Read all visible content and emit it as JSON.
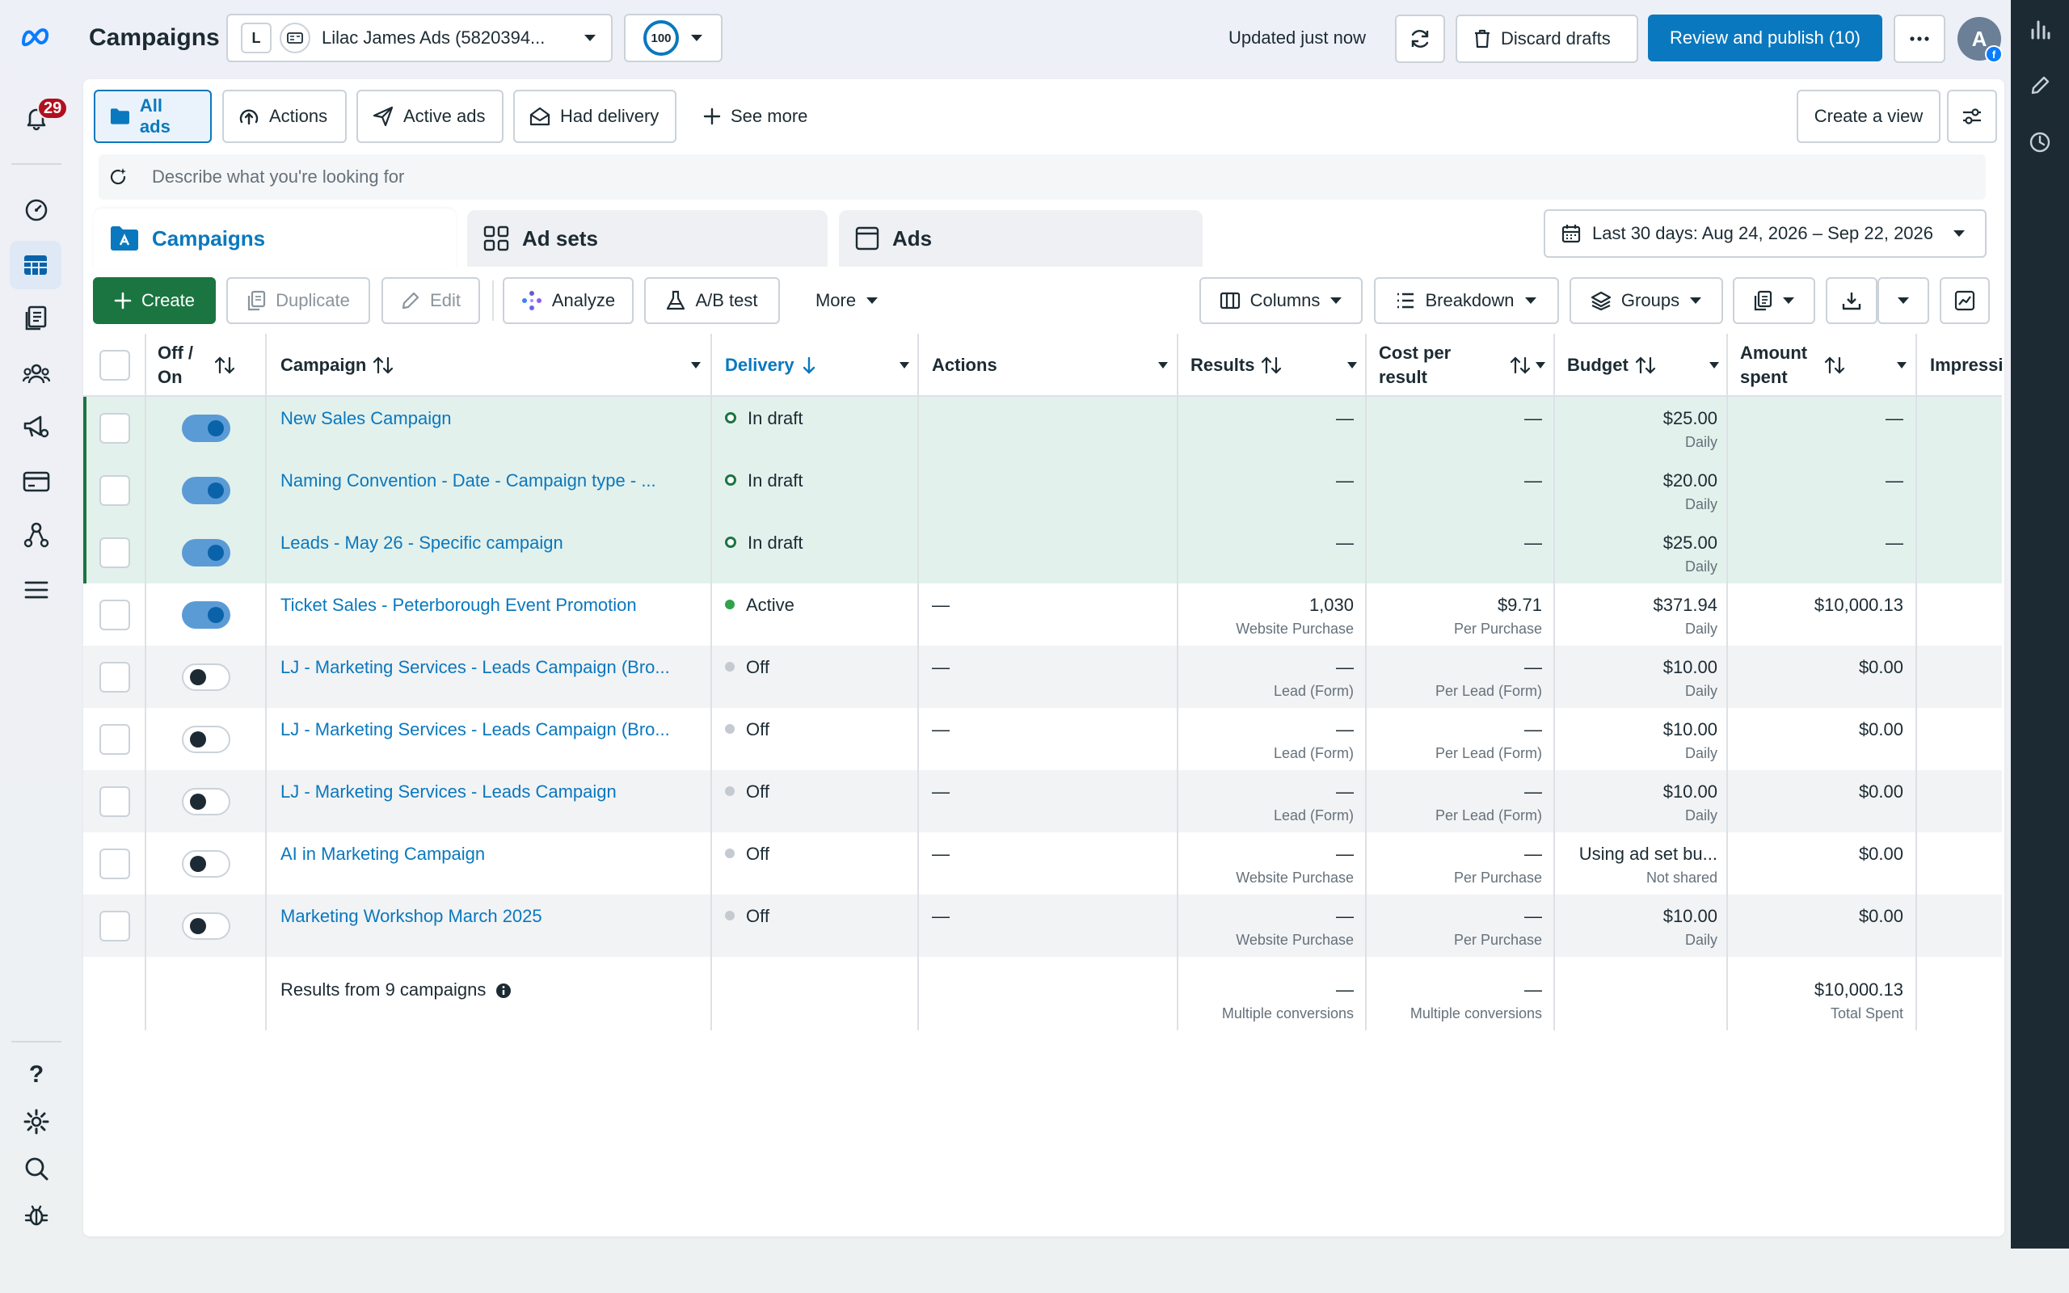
{
  "app": {
    "title": "Campaigns",
    "account_letter": "L",
    "account_name": "Lilac James Ads (5820394...",
    "score": "100",
    "updated_text": "Updated just now",
    "discard_label": "Discard drafts",
    "publish_label": "Review and publish (10)",
    "avatar_letter": "A",
    "notification_count": "29"
  },
  "views": {
    "items": [
      "All ads",
      "Actions",
      "Active ads",
      "Had delivery"
    ],
    "see_more": "See more",
    "create_view": "Create a view",
    "search_placeholder": "Describe what you're looking for"
  },
  "tabs": [
    "Campaigns",
    "Ad sets",
    "Ads"
  ],
  "date_range": "Last 30 days: Aug 24, 2026 – Sep 22, 2026",
  "toolbar": {
    "create": "Create",
    "duplicate": "Duplicate",
    "edit": "Edit",
    "analyze": "Analyze",
    "ab_test": "A/B test",
    "more": "More",
    "columns": "Columns",
    "breakdown": "Breakdown",
    "groups": "Groups"
  },
  "table": {
    "headers": {
      "off_on": "Off / On",
      "campaign": "Campaign",
      "delivery": "Delivery",
      "actions": "Actions",
      "results": "Results",
      "cost_per_result": "Cost per result",
      "budget": "Budget",
      "amount_spent": "Amount spent",
      "impressions": "Impressi"
    },
    "rows": [
      {
        "on": true,
        "draft": true,
        "name": "New Sales Campaign",
        "delivery": "In draft",
        "status": "draft",
        "actions": "",
        "results": "—",
        "results_sub": "",
        "cpr": "—",
        "cpr_sub": "",
        "budget": "$25.00",
        "budget_sub": "Daily",
        "spent": "—"
      },
      {
        "on": true,
        "draft": true,
        "name": "Naming Convention - Date - Campaign type - ...",
        "delivery": "In draft",
        "status": "draft",
        "actions": "",
        "results": "—",
        "results_sub": "",
        "cpr": "—",
        "cpr_sub": "",
        "budget": "$20.00",
        "budget_sub": "Daily",
        "spent": "—"
      },
      {
        "on": true,
        "draft": true,
        "name": "Leads - May 26 - Specific campaign",
        "delivery": "In draft",
        "status": "draft",
        "actions": "",
        "results": "—",
        "results_sub": "",
        "cpr": "—",
        "cpr_sub": "",
        "budget": "$25.00",
        "budget_sub": "Daily",
        "spent": "—"
      },
      {
        "on": true,
        "draft": false,
        "name": "Ticket Sales - Peterborough Event Promotion",
        "delivery": "Active",
        "status": "active",
        "actions": "—",
        "results": "1,030",
        "results_sub": "Website Purchase",
        "cpr": "$9.71",
        "cpr_sub": "Per Purchase",
        "budget": "$371.94",
        "budget_sub": "Daily",
        "spent": "$10,000.13"
      },
      {
        "on": false,
        "draft": false,
        "name": "LJ - Marketing Services - Leads Campaign (Bro...",
        "delivery": "Off",
        "status": "off",
        "actions": "—",
        "results": "—",
        "results_sub": "Lead (Form)",
        "cpr": "—",
        "cpr_sub": "Per Lead (Form)",
        "budget": "$10.00",
        "budget_sub": "Daily",
        "spent": "$0.00"
      },
      {
        "on": false,
        "draft": false,
        "name": "LJ - Marketing Services - Leads Campaign (Bro...",
        "delivery": "Off",
        "status": "off",
        "actions": "—",
        "results": "—",
        "results_sub": "Lead (Form)",
        "cpr": "—",
        "cpr_sub": "Per Lead (Form)",
        "budget": "$10.00",
        "budget_sub": "Daily",
        "spent": "$0.00"
      },
      {
        "on": false,
        "draft": false,
        "name": "LJ - Marketing Services - Leads Campaign",
        "delivery": "Off",
        "status": "off",
        "actions": "—",
        "results": "—",
        "results_sub": "Lead (Form)",
        "cpr": "—",
        "cpr_sub": "Per Lead (Form)",
        "budget": "$10.00",
        "budget_sub": "Daily",
        "spent": "$0.00"
      },
      {
        "on": false,
        "draft": false,
        "name": "AI in Marketing Campaign",
        "delivery": "Off",
        "status": "off",
        "actions": "—",
        "results": "—",
        "results_sub": "Website Purchase",
        "cpr": "—",
        "cpr_sub": "Per Purchase",
        "budget": "Using ad set bu...",
        "budget_sub": "Not shared",
        "spent": "$0.00"
      },
      {
        "on": false,
        "draft": false,
        "name": "Marketing Workshop March 2025",
        "delivery": "Off",
        "status": "off",
        "actions": "—",
        "results": "—",
        "results_sub": "Website Purchase",
        "cpr": "—",
        "cpr_sub": "Per Purchase",
        "budget": "$10.00",
        "budget_sub": "Daily",
        "spent": "$0.00"
      }
    ],
    "summary": {
      "label": "Results from 9 campaigns",
      "results": "—",
      "results_sub": "Multiple conversions",
      "cpr": "—",
      "cpr_sub": "Multiple conversions",
      "spent": "$10,000.13",
      "spent_sub": "Total Spent"
    }
  }
}
